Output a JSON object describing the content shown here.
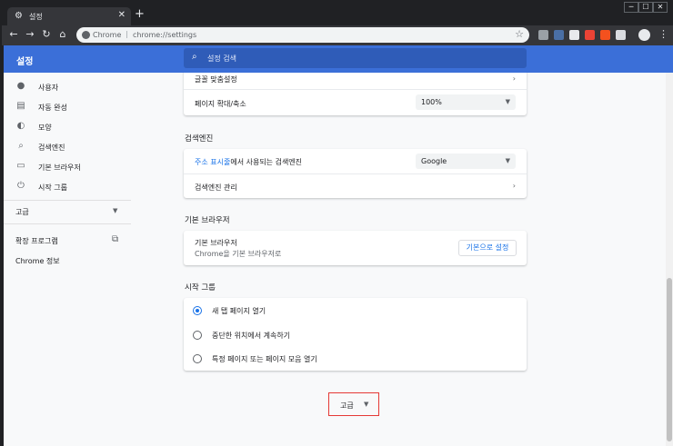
{
  "tab": {
    "title": "설정",
    "close": "✕"
  },
  "newtab": "+",
  "window_controls": [
    "─",
    "☐",
    "✕"
  ],
  "omnibox": {
    "site": "Chrome",
    "separator": "|",
    "url": "chrome://settings"
  },
  "header": {
    "title": "설정",
    "search_placeholder": "설정 검색"
  },
  "sidebar": {
    "items": [
      {
        "label": "사용자",
        "icon": "person-icon"
      },
      {
        "label": "자동 완성",
        "icon": "clipboard-icon"
      },
      {
        "label": "모양",
        "icon": "palette-icon"
      },
      {
        "label": "검색엔진",
        "icon": "search-icon"
      },
      {
        "label": "기본 브라우저",
        "icon": "browser-icon"
      },
      {
        "label": "시작 그룹",
        "icon": "power-icon"
      }
    ],
    "advanced": "고급",
    "extensions": "확장 프로그램",
    "about": "Chrome 정보"
  },
  "appearance": {
    "font_settings": "글꼴 맞춤설정",
    "page_zoom": "페이지 확대/축소",
    "page_zoom_value": "100%"
  },
  "search_engine": {
    "section": "검색엔진",
    "address_bar_link": "주소 표시줄",
    "address_bar_text": "에서 사용되는 검색엔진",
    "engine_value": "Google",
    "manage": "검색엔진 관리"
  },
  "default_browser": {
    "section": "기본 브라우저",
    "title": "기본 브라우저",
    "subtitle": "Chrome을 기본 브라우저로",
    "button": "기본으로 설정"
  },
  "on_startup": {
    "section": "시작 그룹",
    "options": [
      {
        "label": "새 탭 페이지 열기",
        "selected": true
      },
      {
        "label": "중단한 위치에서 계속하기",
        "selected": false
      },
      {
        "label": "특정 페이지 또는 페이지 모음 열기",
        "selected": false
      }
    ]
  },
  "advanced_button": "고급",
  "colors": {
    "header_blue": "#3b6fd8",
    "link_blue": "#1a73e8",
    "highlight_red": "#e53935"
  }
}
